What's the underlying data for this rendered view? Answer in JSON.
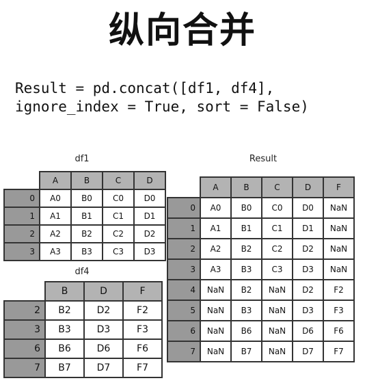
{
  "title": "纵向合并",
  "code": {
    "line1": "Result = pd.concat([df1, df4],",
    "line2": "ignore_index = True, sort = False)"
  },
  "df1": {
    "label": "df1",
    "columns": [
      "A",
      "B",
      "C",
      "D"
    ],
    "index": [
      "0",
      "1",
      "2",
      "3"
    ],
    "rows": [
      [
        "A0",
        "B0",
        "C0",
        "D0"
      ],
      [
        "A1",
        "B1",
        "C1",
        "D1"
      ],
      [
        "A2",
        "B2",
        "C2",
        "D2"
      ],
      [
        "A3",
        "B3",
        "C3",
        "D3"
      ]
    ]
  },
  "df4": {
    "label": "df4",
    "columns": [
      "B",
      "D",
      "F"
    ],
    "index": [
      "2",
      "3",
      "6",
      "7"
    ],
    "rows": [
      [
        "B2",
        "D2",
        "F2"
      ],
      [
        "B3",
        "D3",
        "F3"
      ],
      [
        "B6",
        "D6",
        "F6"
      ],
      [
        "B7",
        "D7",
        "F7"
      ]
    ]
  },
  "result": {
    "label": "Result",
    "columns": [
      "A",
      "B",
      "C",
      "D",
      "F"
    ],
    "index": [
      "0",
      "1",
      "2",
      "3",
      "4",
      "5",
      "6",
      "7"
    ],
    "rows": [
      [
        "A0",
        "B0",
        "C0",
        "D0",
        "NaN"
      ],
      [
        "A1",
        "B1",
        "C1",
        "D1",
        "NaN"
      ],
      [
        "A2",
        "B2",
        "C2",
        "D2",
        "NaN"
      ],
      [
        "A3",
        "B3",
        "C3",
        "D3",
        "NaN"
      ],
      [
        "NaN",
        "B2",
        "NaN",
        "D2",
        "F2"
      ],
      [
        "NaN",
        "B3",
        "NaN",
        "D3",
        "F3"
      ],
      [
        "NaN",
        "B6",
        "NaN",
        "D6",
        "F6"
      ],
      [
        "NaN",
        "B7",
        "NaN",
        "D7",
        "F7"
      ]
    ]
  }
}
